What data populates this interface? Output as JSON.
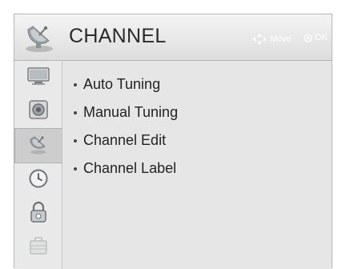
{
  "header": {
    "title": "CHANNEL",
    "icon": "satellite-dish-icon",
    "hints": [
      {
        "icon": "dpad-arrows-icon",
        "label": "Move"
      },
      {
        "icon": "ok-circle-icon",
        "label": "OK"
      }
    ]
  },
  "sidebar": {
    "items": [
      {
        "name": "picture",
        "icon": "tv-screen-icon",
        "active": false
      },
      {
        "name": "sound",
        "icon": "speaker-icon",
        "active": false
      },
      {
        "name": "channel",
        "icon": "satellite-dish-icon",
        "active": true
      },
      {
        "name": "time",
        "icon": "clock-icon",
        "active": false
      },
      {
        "name": "lock",
        "icon": "padlock-icon",
        "active": false
      },
      {
        "name": "setup",
        "icon": "briefcase-icon",
        "active": false
      }
    ]
  },
  "menu": {
    "items": [
      {
        "label": "Auto Tuning"
      },
      {
        "label": "Manual Tuning"
      },
      {
        "label": "Channel Edit"
      },
      {
        "label": "Channel Label"
      }
    ]
  },
  "colors": {
    "panel_bg": "#e6e6e6",
    "header_bg": "#eaeaea",
    "border": "#b8b8b8",
    "text": "#222222",
    "hint_text": "#ffffff"
  }
}
